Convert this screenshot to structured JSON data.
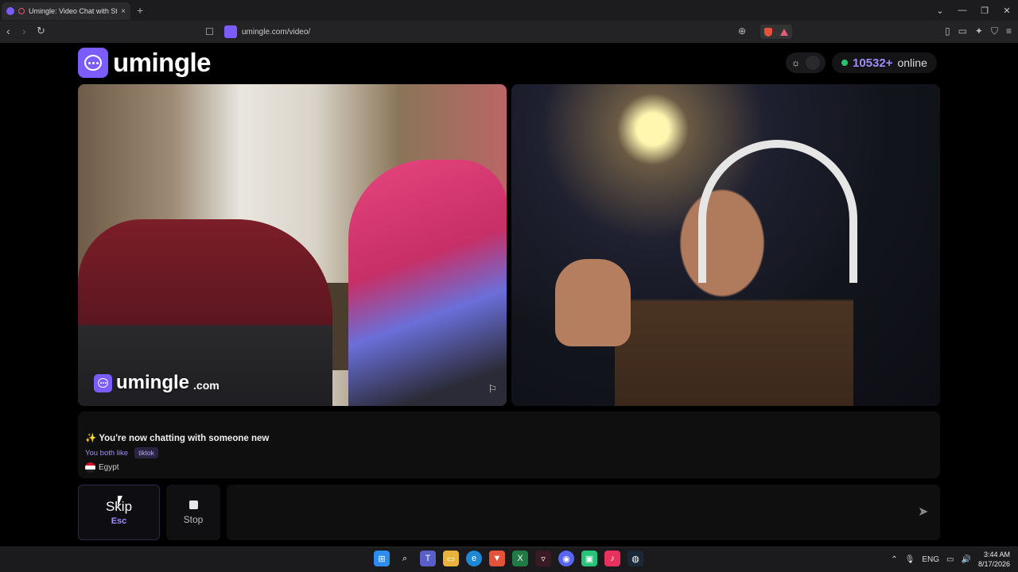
{
  "browser": {
    "tab_title": "Umingle: Video Chat with Str",
    "tab_close": "×",
    "new_tab": "+",
    "url": "umingle.com/video/",
    "window_controls": {
      "chevron": "⌄",
      "minimize": "—",
      "restore": "❐",
      "close": "✕"
    }
  },
  "header": {
    "logo_text": "umingle",
    "online_count": "10532+",
    "online_label": "online"
  },
  "videos": {
    "watermark_word": "umingle",
    "watermark_domain": ".com"
  },
  "chat": {
    "status_emoji": "✨",
    "status_text": "You're now chatting with someone new",
    "common_label": "You both like",
    "common_interest": "tiktok",
    "country": "Egypt"
  },
  "controls": {
    "skip_label": "Skip",
    "skip_shortcut": "Esc",
    "stop_label": "Stop",
    "message_placeholder": ""
  },
  "taskbar": {
    "language": "ENG",
    "time": "3:44 AM",
    "date": "8/17/2026"
  },
  "colors": {
    "accent": "#7b5cff",
    "online_dot": "#29c46b",
    "count_text": "#9f8bff"
  },
  "icons": [
    "back-icon",
    "forward-icon",
    "reload-icon",
    "bookmark-icon",
    "zoom-icon",
    "brave-shield-icon",
    "sun-icon",
    "flag-icon",
    "send-icon",
    "stop-icon"
  ]
}
